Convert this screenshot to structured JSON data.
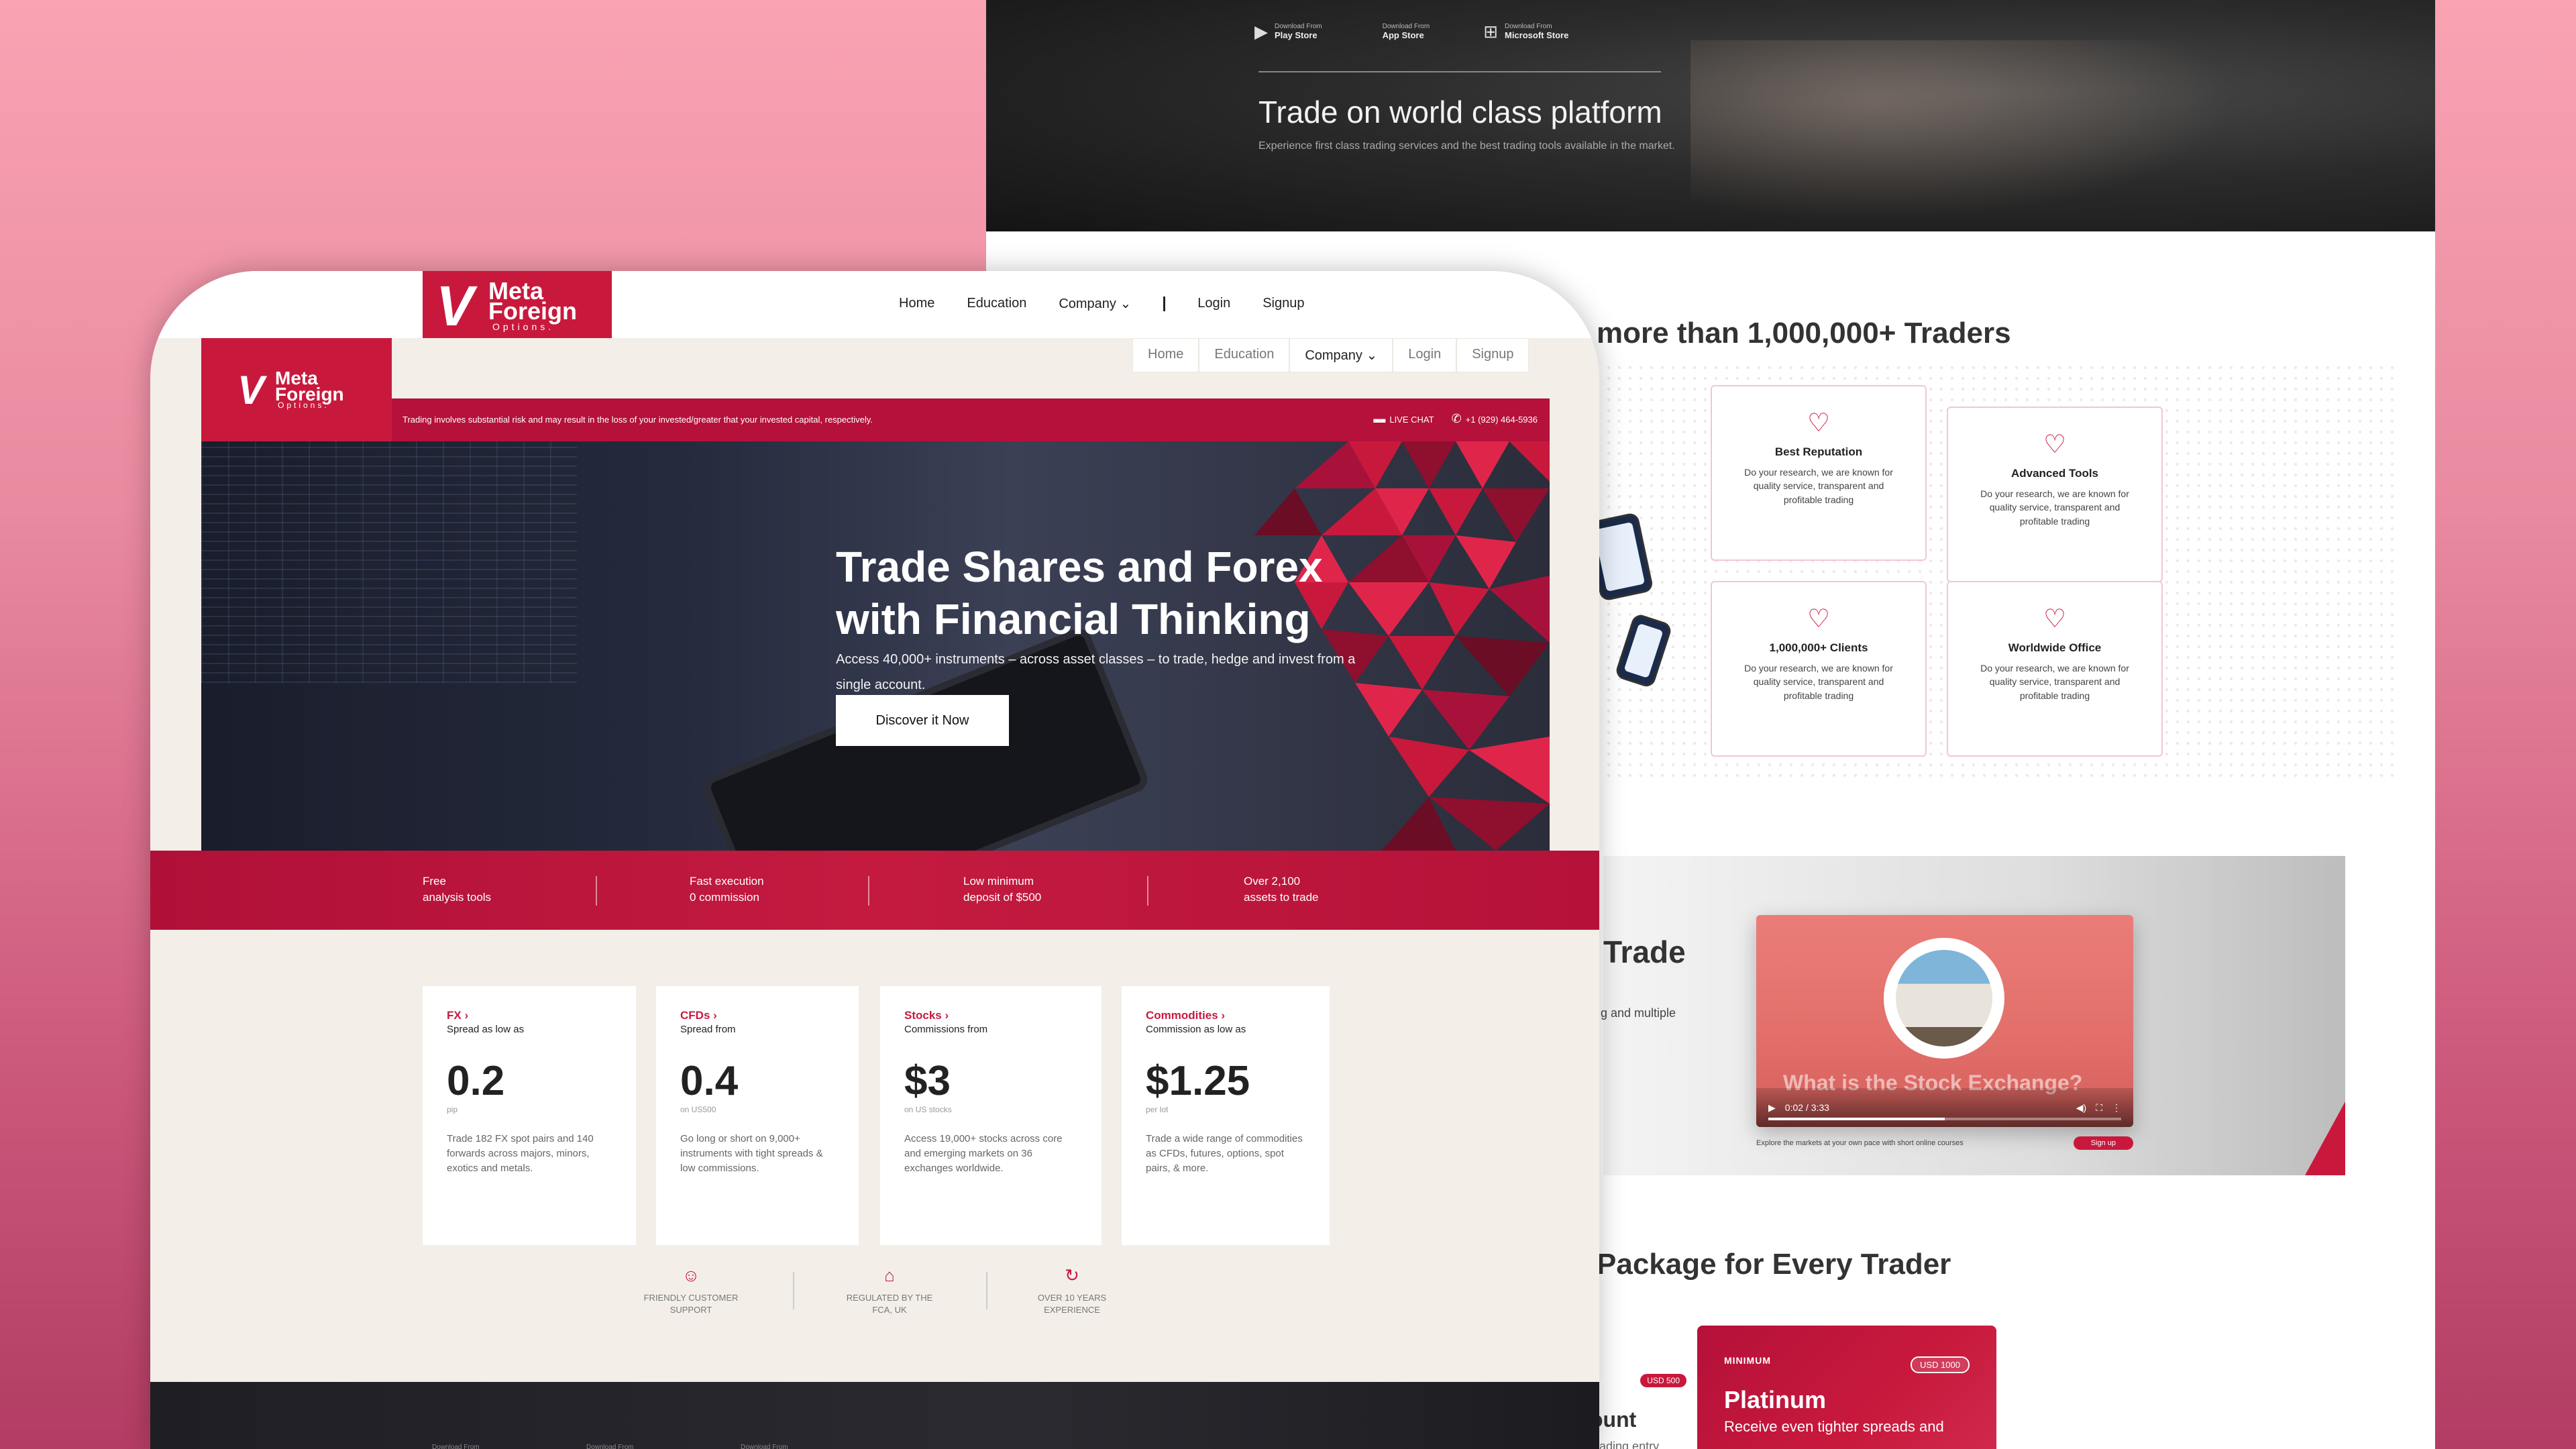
{
  "back": {
    "stores": [
      {
        "icon": "▶",
        "small": "Download From",
        "big": "Play Store"
      },
      {
        "icon": "",
        "small": "Download From",
        "big": "App Store"
      },
      {
        "icon": "⊞",
        "small": "Download From",
        "big": "Microsoft Store"
      }
    ],
    "hero_title": "Trade on world class platform",
    "hero_sub": "Experience first class trading services and the best trading tools available in the market.",
    "traders_heading": "more than 1,000,000+ Traders",
    "features": [
      {
        "title": "Best Reputation",
        "desc": "Do your research, we are known for quality service, transparent and profitable trading"
      },
      {
        "title": "Advanced Tools",
        "desc": "Do your research, we are known for quality service, transparent and profitable trading"
      },
      {
        "title": "1,000,000+ Clients",
        "desc": "Do your research, we are known for quality service, transparent and profitable trading"
      },
      {
        "title": "Worldwide Office",
        "desc": "Do your research, we are known for quality service, transparent and profitable trading"
      }
    ],
    "trade_heading": "Trade",
    "trade_sub": "g and multiple",
    "video": {
      "title": "What is the Stock Exchange?",
      "time": "0:02 / 3:33",
      "explore_text": "Explore the markets at your own pace with short online courses",
      "signup": "Sign up"
    },
    "package_heading": "Package for Every Trader",
    "pkg_small": {
      "badge": "USD 500",
      "name": "ount",
      "sub": "leading entry"
    },
    "pkg_card": {
      "label": "MINIMUM",
      "badge": "USD 1000",
      "name": "Platinum",
      "desc": "Receive even tighter spreads and"
    }
  },
  "front": {
    "logo": {
      "v": "V",
      "line1": "Meta",
      "line2": "Foreign",
      "line3": "Options."
    },
    "nav": [
      "Home",
      "Education",
      "Company ⌄",
      "Login",
      "Signup"
    ],
    "inner_nav": [
      "Home",
      "Education",
      "Company ⌄",
      "Login",
      "Signup"
    ],
    "risk_text": "Trading involves substantial risk and may result in the loss of your invested/greater that your invested capital, respectively.",
    "live_chat": "LIVE CHAT",
    "phone": "+1 (929) 464-5936",
    "hero_title_1": "Trade Shares and Forex",
    "hero_title_2": "with Financial Thinking",
    "hero_sub": "Access 40,000+ instruments – across asset classes – to trade, hedge and invest from a single account.",
    "hero_btn": "Discover it Now",
    "strip": [
      {
        "l1": "Free",
        "l2": "analysis tools"
      },
      {
        "l1": "Fast execution",
        "l2": "0 commission"
      },
      {
        "l1": "Low minimum",
        "l2": "deposit of $500"
      },
      {
        "l1": "Over 2,100",
        "l2": "assets to trade"
      }
    ],
    "cards": [
      {
        "cat": "FX ›",
        "label": "Spread as low as",
        "value": "0.2",
        "unit": "pip",
        "desc": "Trade 182 FX spot pairs and 140 forwards across majors, minors, exotics and metals."
      },
      {
        "cat": "CFDs ›",
        "label": "Spread from",
        "value": "0.4",
        "unit": "on US500",
        "desc": "Go long or short on 9,000+ instruments with tight spreads & low commissions."
      },
      {
        "cat": "Stocks ›",
        "label": "Commissions from",
        "value": "$3",
        "unit": "on US stocks",
        "desc": "Access 19,000+ stocks across core and emerging markets on 36 exchanges worldwide."
      },
      {
        "cat": "Commodities ›",
        "label": "Commission as low as",
        "value": "$1.25",
        "unit": "per lot",
        "desc": "Trade a wide range of commodities as CFDs, futures, options, spot pairs, & more."
      }
    ],
    "badges": [
      {
        "icon": "☺",
        "l1": "FRIENDLY CUSTOMER",
        "l2": "SUPPORT"
      },
      {
        "icon": "⌂",
        "l1": "REGULATED BY THE",
        "l2": "FCA, UK"
      },
      {
        "icon": "↻",
        "l1": "OVER 10 YEARS",
        "l2": "EXPERIENCE"
      }
    ],
    "bottom_stores": [
      "Download From",
      "Download From",
      "Download From"
    ]
  },
  "colors": {
    "brand": "#c8193c",
    "brand_dark": "#b5113a",
    "page_bg": "#f3efe8"
  }
}
